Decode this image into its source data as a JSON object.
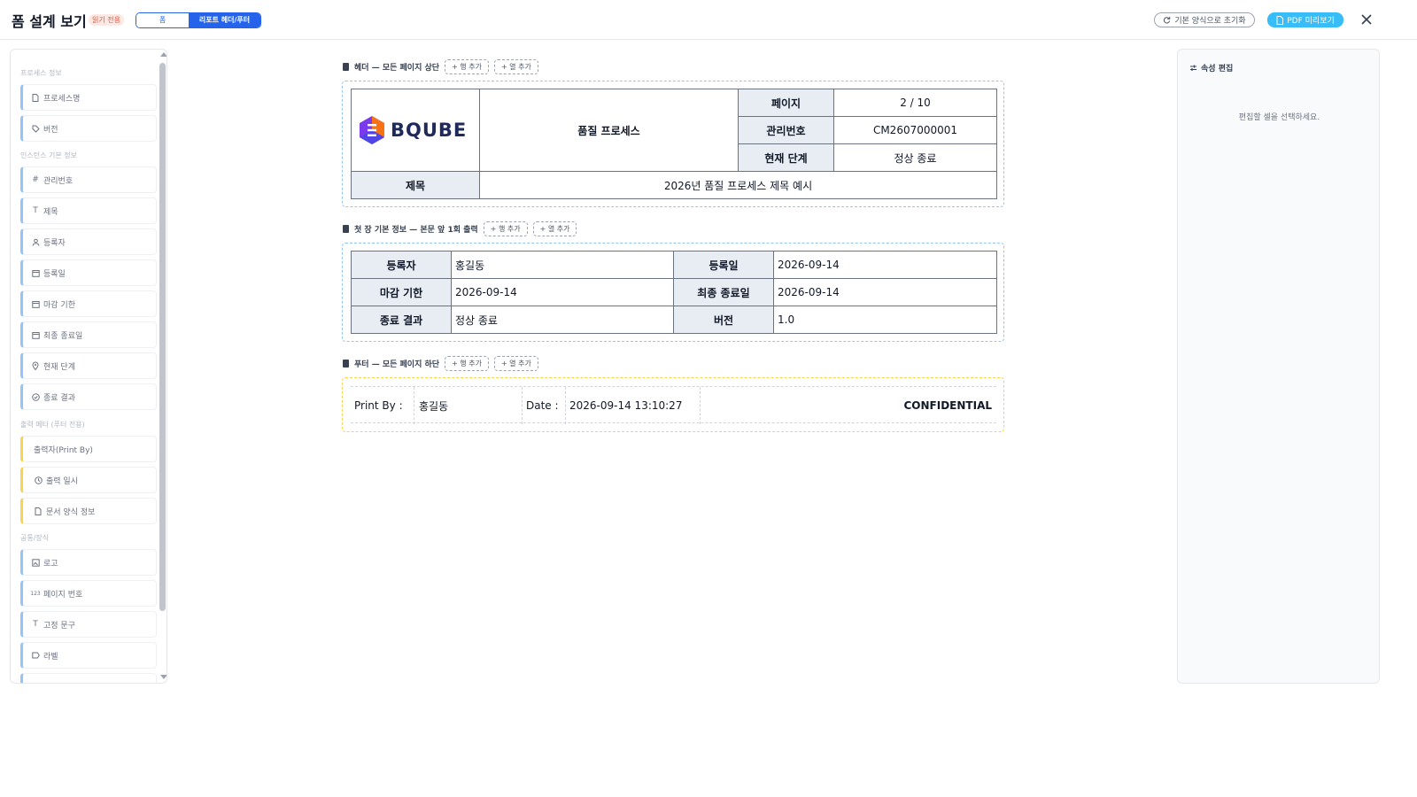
{
  "header": {
    "title": "폼 설계 보기",
    "read_only_badge": "읽기 전용",
    "view_tabs": [
      "폼",
      "리포트 헤더/푸터"
    ],
    "active_tab": "리포트 헤더/푸터",
    "reset_label": "기본 양식으로 초기화",
    "pdf_label": "PDF 미리보기"
  },
  "palette": {
    "groups": [
      {
        "title": "프로세스 정보",
        "items": [
          {
            "label": "프로세스명",
            "icon": "document-icon"
          },
          {
            "label": "버전",
            "icon": "tag-icon"
          }
        ]
      },
      {
        "title": "인스턴스 기본 정보",
        "items": [
          {
            "label": "관리번호",
            "icon": "hash-icon"
          },
          {
            "label": "제목",
            "icon": "text-icon"
          },
          {
            "label": "등록자",
            "icon": "user-icon"
          },
          {
            "label": "등록일",
            "icon": "calendar-icon"
          },
          {
            "label": "마감 기한",
            "icon": "calendar-icon"
          },
          {
            "label": "최종 종료일",
            "icon": "calendar-icon"
          },
          {
            "label": "현재 단계",
            "icon": "pin-icon"
          },
          {
            "label": "종료 결과",
            "icon": "check-circle-icon"
          }
        ]
      },
      {
        "title": "출력 메타 (푸터 전용)",
        "items": [
          {
            "label": "출력자(Print By)",
            "icon": ""
          },
          {
            "label": "출력 일시",
            "icon": "clock-icon"
          },
          {
            "label": "문서 양식 정보",
            "icon": "document-icon"
          }
        ]
      },
      {
        "title": "공통/장식",
        "items": [
          {
            "label": "로고",
            "icon": "image-icon"
          },
          {
            "label": "페이지 번호",
            "icon": "number-icon"
          },
          {
            "label": "고정 문구",
            "icon": "text-icon"
          },
          {
            "label": "라벨",
            "icon": "label-icon"
          }
        ]
      }
    ]
  },
  "sections": {
    "header_title": "헤더 — 모든 페이지 상단",
    "first_title": "첫 장 기본 정보 — 본문 앞 1회 출력",
    "footer_title": "푸터 — 모든 페이지 하단",
    "add_row": "+ 행 추가",
    "add_col": "+ 열 추가"
  },
  "report_header": {
    "logo_text": "BQUBE",
    "doc_title": "품질 프로세스",
    "page_label": "페이지",
    "page_value": "2 / 10",
    "mgmt_label": "관리번호",
    "mgmt_value": "CM2607000001",
    "stage_label": "현재 단계",
    "stage_value": "정상 종료",
    "subject_label": "제목",
    "subject_value": "2026년 품질 프로세스 제목 예시"
  },
  "first_page": {
    "rows": [
      {
        "l1": "등록자",
        "v1": "홍길동",
        "l2": "등록일",
        "v2": "2026-09-14"
      },
      {
        "l1": "마감 기한",
        "v1": "2026-09-14",
        "l2": "최종 종료일",
        "v2": "2026-09-14"
      },
      {
        "l1": "종료 결과",
        "v1": "정상 종료",
        "l2": "버전",
        "v2": "1.0"
      }
    ]
  },
  "footer": {
    "print_by_label": "Print By :",
    "print_by_value": "홍길동",
    "date_label": "Date :",
    "date_value": "2026-09-14 13:10:27",
    "confidential": "CONFIDENTIAL"
  },
  "props_panel": {
    "title": "속성 편집",
    "empty_text": "편집할 셀을 선택하세요."
  },
  "colors": {
    "accent": "#2563eb",
    "pdf_button": "#38bdf8",
    "header_frame": "#93c5fd",
    "footer_frame": "#fcd34d",
    "label_bg": "#e8edf3"
  }
}
